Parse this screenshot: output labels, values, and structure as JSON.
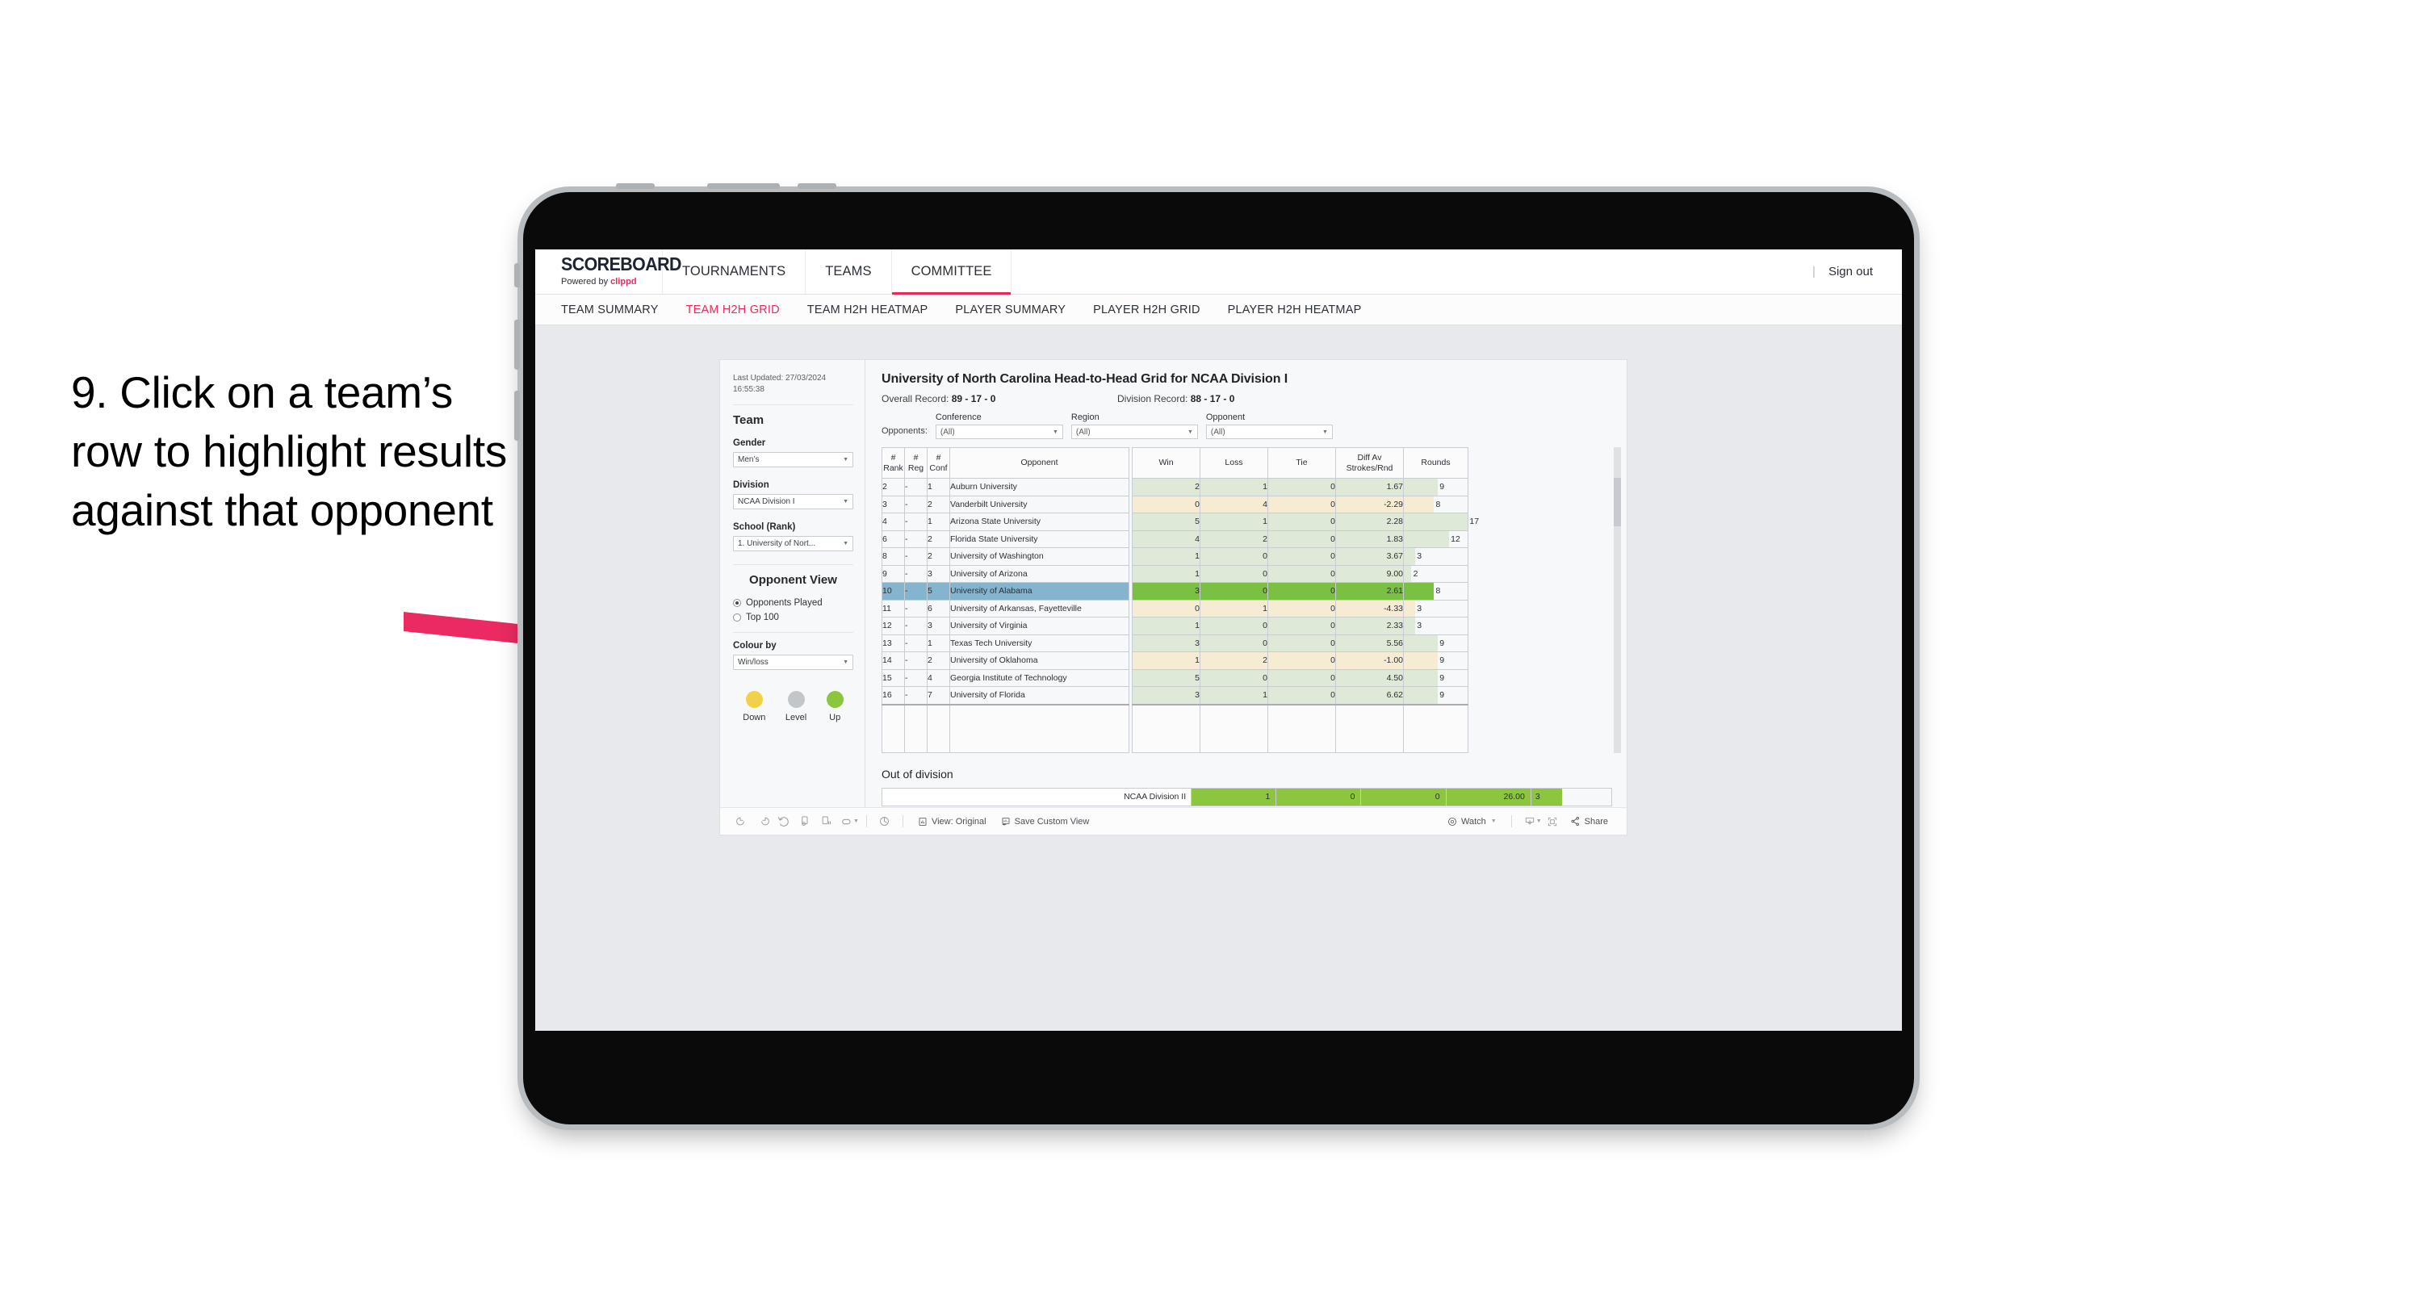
{
  "caption": "9. Click on a team’s row to highlight results against that opponent",
  "colors": {
    "accent_pink": "#ea2b5c",
    "arrow_pink": "#ea2a60",
    "selected_row_blue": "#85b4ce",
    "win_green": "#7ac143",
    "dim_green": "#dfe9d7",
    "dim_amber": "#f6ecd4",
    "legend_down": "#f2d149",
    "legend_level": "#c3c6c9",
    "legend_up": "#8cc63f"
  },
  "topnav": {
    "brand_logo": "SCOREBOARD",
    "brand_tagline_prefix": "Powered by ",
    "brand_tagline_name": "clippd",
    "tabs": [
      {
        "label": "TOURNAMENTS",
        "active": false
      },
      {
        "label": "TEAMS",
        "active": false
      },
      {
        "label": "COMMITTEE",
        "active": true
      }
    ],
    "divider": "|",
    "sign_out": "Sign out"
  },
  "subnav": {
    "tabs": [
      {
        "label": "TEAM SUMMARY",
        "active": false
      },
      {
        "label": "TEAM H2H GRID",
        "active": true
      },
      {
        "label": "TEAM H2H HEATMAP",
        "active": false
      },
      {
        "label": "PLAYER SUMMARY",
        "active": false
      },
      {
        "label": "PLAYER H2H GRID",
        "active": false
      },
      {
        "label": "PLAYER H2H HEATMAP",
        "active": false
      }
    ]
  },
  "sidebar": {
    "last_updated": "Last Updated: 27/03/2024 16:55:38",
    "team_heading": "Team",
    "gender_label": "Gender",
    "gender_value": "Men’s",
    "division_label": "Division",
    "division_value": "NCAA Division I",
    "school_label": "School (Rank)",
    "school_value": "1. University of Nort...",
    "opponent_view_heading": "Opponent View",
    "opponent_view_options": [
      {
        "label": "Opponents Played",
        "selected": true
      },
      {
        "label": "Top 100",
        "selected": false
      }
    ],
    "colour_by_label": "Colour by",
    "colour_by_value": "Win/loss",
    "legend": [
      {
        "label": "Down",
        "color": "#f2d149"
      },
      {
        "label": "Level",
        "color": "#c3c6c9"
      },
      {
        "label": "Up",
        "color": "#8cc63f"
      }
    ]
  },
  "main": {
    "title": "University of North Carolina Head-to-Head Grid for NCAA Division I",
    "overall_record_label": "Overall Record: ",
    "overall_record_value": "89 - 17 - 0",
    "division_record_label": "Division Record: ",
    "division_record_value": "88 - 17 - 0",
    "opponents_label": "Opponents:",
    "filters": [
      {
        "label": "Conference",
        "value": "(All)"
      },
      {
        "label": "Region",
        "value": "(All)"
      },
      {
        "label": "Opponent",
        "value": "(All)"
      }
    ],
    "out_of_division_heading": "Out of division",
    "out_of_division_row": {
      "label": "NCAA Division II",
      "win": "1",
      "loss": "0",
      "tie": "0",
      "diff": "26.00",
      "rounds": "3"
    }
  },
  "chart_data": {
    "type": "table",
    "title": "University of North Carolina Head-to-Head Grid for NCAA Division I",
    "columns": [
      "# Rank",
      "# Reg",
      "# Conf",
      "Opponent",
      "Win",
      "Loss",
      "Tie",
      "Diff Av Strokes/Rnd",
      "Rounds"
    ],
    "header_lines": {
      "rank": [
        "#",
        "Rank"
      ],
      "reg": [
        "#",
        "Reg"
      ],
      "conf": [
        "#",
        "Conf"
      ],
      "opponent": [
        "Opponent"
      ],
      "win": [
        "Win"
      ],
      "loss": [
        "Loss"
      ],
      "tie": [
        "Tie"
      ],
      "diff": [
        "Diff Av",
        "Strokes/Rnd"
      ],
      "rounds": [
        "Rounds"
      ]
    },
    "rounds_max": 17,
    "rows": [
      {
        "rank": "2",
        "reg": "-",
        "conf": "1",
        "opponent": "Auburn University",
        "win": "2",
        "loss": "1",
        "tie": "0",
        "diff": "1.67",
        "rounds": "9",
        "tone": "up",
        "selected": false
      },
      {
        "rank": "3",
        "reg": "-",
        "conf": "2",
        "opponent": "Vanderbilt University",
        "win": "0",
        "loss": "4",
        "tie": "0",
        "diff": "-2.29",
        "rounds": "8",
        "tone": "down",
        "selected": false
      },
      {
        "rank": "4",
        "reg": "-",
        "conf": "1",
        "opponent": "Arizona State University",
        "win": "5",
        "loss": "1",
        "tie": "0",
        "diff": "2.28",
        "rounds": "17",
        "tone": "up",
        "selected": false
      },
      {
        "rank": "6",
        "reg": "-",
        "conf": "2",
        "opponent": "Florida State University",
        "win": "4",
        "loss": "2",
        "tie": "0",
        "diff": "1.83",
        "rounds": "12",
        "tone": "up",
        "selected": false
      },
      {
        "rank": "8",
        "reg": "-",
        "conf": "2",
        "opponent": "University of Washington",
        "win": "1",
        "loss": "0",
        "tie": "0",
        "diff": "3.67",
        "rounds": "3",
        "tone": "up",
        "selected": false
      },
      {
        "rank": "9",
        "reg": "-",
        "conf": "3",
        "opponent": "University of Arizona",
        "win": "1",
        "loss": "0",
        "tie": "0",
        "diff": "9.00",
        "rounds": "2",
        "tone": "up",
        "selected": false
      },
      {
        "rank": "10",
        "reg": "-",
        "conf": "5",
        "opponent": "University of Alabama",
        "win": "3",
        "loss": "0",
        "tie": "0",
        "diff": "2.61",
        "rounds": "8",
        "tone": "up",
        "selected": true
      },
      {
        "rank": "11",
        "reg": "-",
        "conf": "6",
        "opponent": "University of Arkansas, Fayetteville",
        "win": "0",
        "loss": "1",
        "tie": "0",
        "diff": "-4.33",
        "rounds": "3",
        "tone": "down",
        "selected": false
      },
      {
        "rank": "12",
        "reg": "-",
        "conf": "3",
        "opponent": "University of Virginia",
        "win": "1",
        "loss": "0",
        "tie": "0",
        "diff": "2.33",
        "rounds": "3",
        "tone": "up",
        "selected": false
      },
      {
        "rank": "13",
        "reg": "-",
        "conf": "1",
        "opponent": "Texas Tech University",
        "win": "3",
        "loss": "0",
        "tie": "0",
        "diff": "5.56",
        "rounds": "9",
        "tone": "up",
        "selected": false
      },
      {
        "rank": "14",
        "reg": "-",
        "conf": "2",
        "opponent": "University of Oklahoma",
        "win": "1",
        "loss": "2",
        "tie": "0",
        "diff": "-1.00",
        "rounds": "9",
        "tone": "down",
        "selected": false
      },
      {
        "rank": "15",
        "reg": "-",
        "conf": "4",
        "opponent": "Georgia Institute of Technology",
        "win": "5",
        "loss": "0",
        "tie": "0",
        "diff": "4.50",
        "rounds": "9",
        "tone": "up",
        "selected": false
      },
      {
        "rank": "16",
        "reg": "-",
        "conf": "7",
        "opponent": "University of Florida",
        "win": "3",
        "loss": "1",
        "tie": "0",
        "diff": "6.62",
        "rounds": "9",
        "tone": "up",
        "selected": false
      }
    ]
  },
  "toolbar": {
    "icons": [
      "undo-icon",
      "redo-icon",
      "revert-icon",
      "refresh-icon",
      "pause-icon",
      "highlight-icon"
    ],
    "view_label": "View: Original",
    "save_view_label": "Save Custom View",
    "watch_label": "Watch",
    "share_label": "Share"
  }
}
